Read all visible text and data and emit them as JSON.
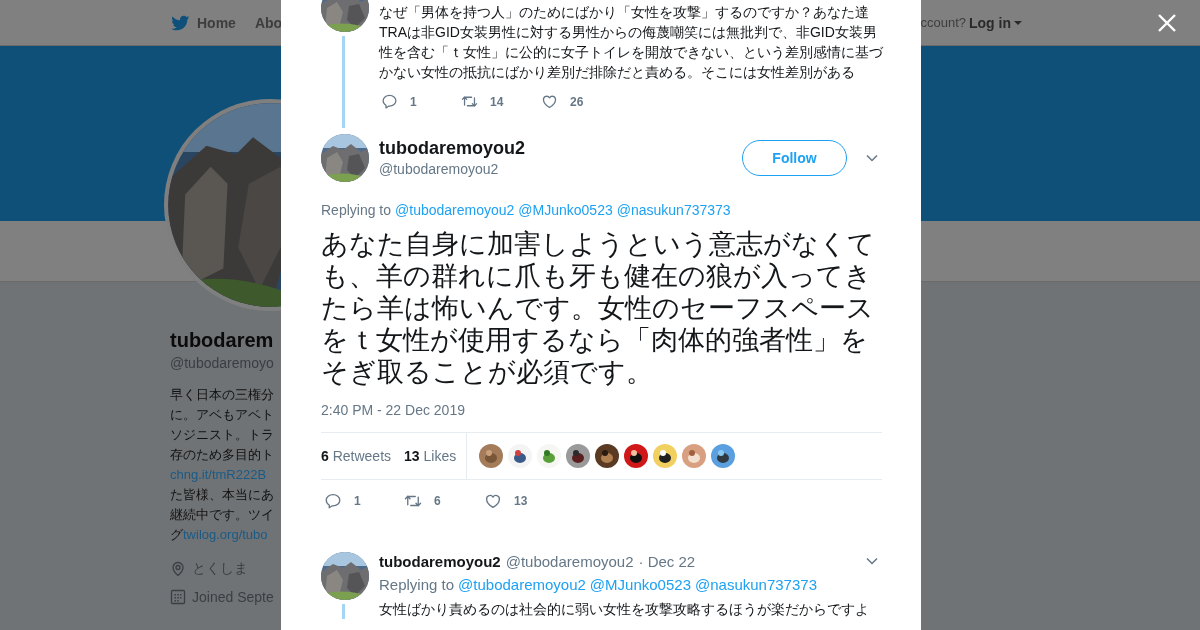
{
  "nav": [
    {
      "label": "Home",
      "kind": "home"
    },
    {
      "label": "Abo",
      "kind": "plain"
    }
  ],
  "login": {
    "prompt": "ccount?",
    "label": "Log in"
  },
  "profile": {
    "name": "tubodarem",
    "handle": "@tubodaremoyo",
    "bio_lines": [
      [
        {
          "kind": "text",
          "text": "早く日本の三権分"
        }
      ],
      [
        {
          "kind": "text",
          "text": "に。アベもアベト"
        }
      ],
      [
        {
          "kind": "text",
          "text": "ソジニスト。トラ"
        }
      ],
      [
        {
          "kind": "text",
          "text": "存のため多目的ト"
        }
      ],
      [
        {
          "kind": "link",
          "text": "chng.it/tmR222B"
        }
      ],
      [
        {
          "kind": "text",
          "text": "た皆様、本当にあ"
        }
      ],
      [
        {
          "kind": "text",
          "text": "継続中です。ツイ"
        }
      ],
      [
        {
          "kind": "text",
          "text": "グ"
        },
        {
          "kind": "link",
          "text": "twilog.org/tubo"
        }
      ]
    ],
    "location": "とくしま",
    "joined": "Joined Septe"
  },
  "context_tweet": {
    "text": "なぜ「男体を持つ人」のためにばかり「女性を攻撃」するのですか？あなた達TRAは非GID女装男性に対する男性からの侮蔑嘲笑には無批判で、非GID女装男性を含む「ｔ女性」に公的に女子トイレを開放できない、という差別感情に基づかない女性の抵抗にばかり差別だ排除だと責める。そこには女性差別がある",
    "actions": [
      {
        "kind": "reply",
        "count": "1"
      },
      {
        "kind": "retweet",
        "count": "14"
      },
      {
        "kind": "like",
        "count": "26"
      }
    ]
  },
  "tweet": {
    "name": "tubodaremoyou2",
    "handle": "@tubodaremoyou2",
    "follow": "Follow",
    "replying_label": "Replying to",
    "mentions": [
      "@tubodaremoyou2",
      "@MJunko0523",
      "@nasukun737373"
    ],
    "text": "あなた自身に加害しようという意志がなくても、羊の群れに爪も牙も健在の狼が入ってきたら羊は怖いんです。女性のセーフスペースをｔ女性が使用するなら「肉体的強者性」をそぎ取ることが必須です。",
    "time": "2:40 PM - 22 Dec 2019",
    "stats": [
      "**6** Retweets",
      "**13** Likes"
    ],
    "likers": [
      {
        "kind": "picture"
      },
      {
        "kind": "picture"
      },
      {
        "kind": "picture"
      },
      {
        "kind": "picture"
      },
      {
        "kind": "picture"
      },
      {
        "kind": "picture"
      },
      {
        "kind": "picture"
      },
      {
        "kind": "picture"
      },
      {
        "kind": "picture"
      }
    ],
    "actions": [
      {
        "kind": "reply",
        "count": "1"
      },
      {
        "kind": "retweet",
        "count": "6"
      },
      {
        "kind": "like",
        "count": "13"
      }
    ]
  },
  "reply_tweet": {
    "name": "tubodaremoyou2",
    "handle": "@tubodaremoyou2",
    "date": "· Dec 22",
    "replying_label": "Replying to",
    "mentions": [
      "@tubodaremoyou2",
      "@MJunko0523",
      "@nasukun737373"
    ],
    "text": "女性ばかり責めるのは社会的に弱い女性を攻撃攻略するほうが楽だからですよ"
  }
}
